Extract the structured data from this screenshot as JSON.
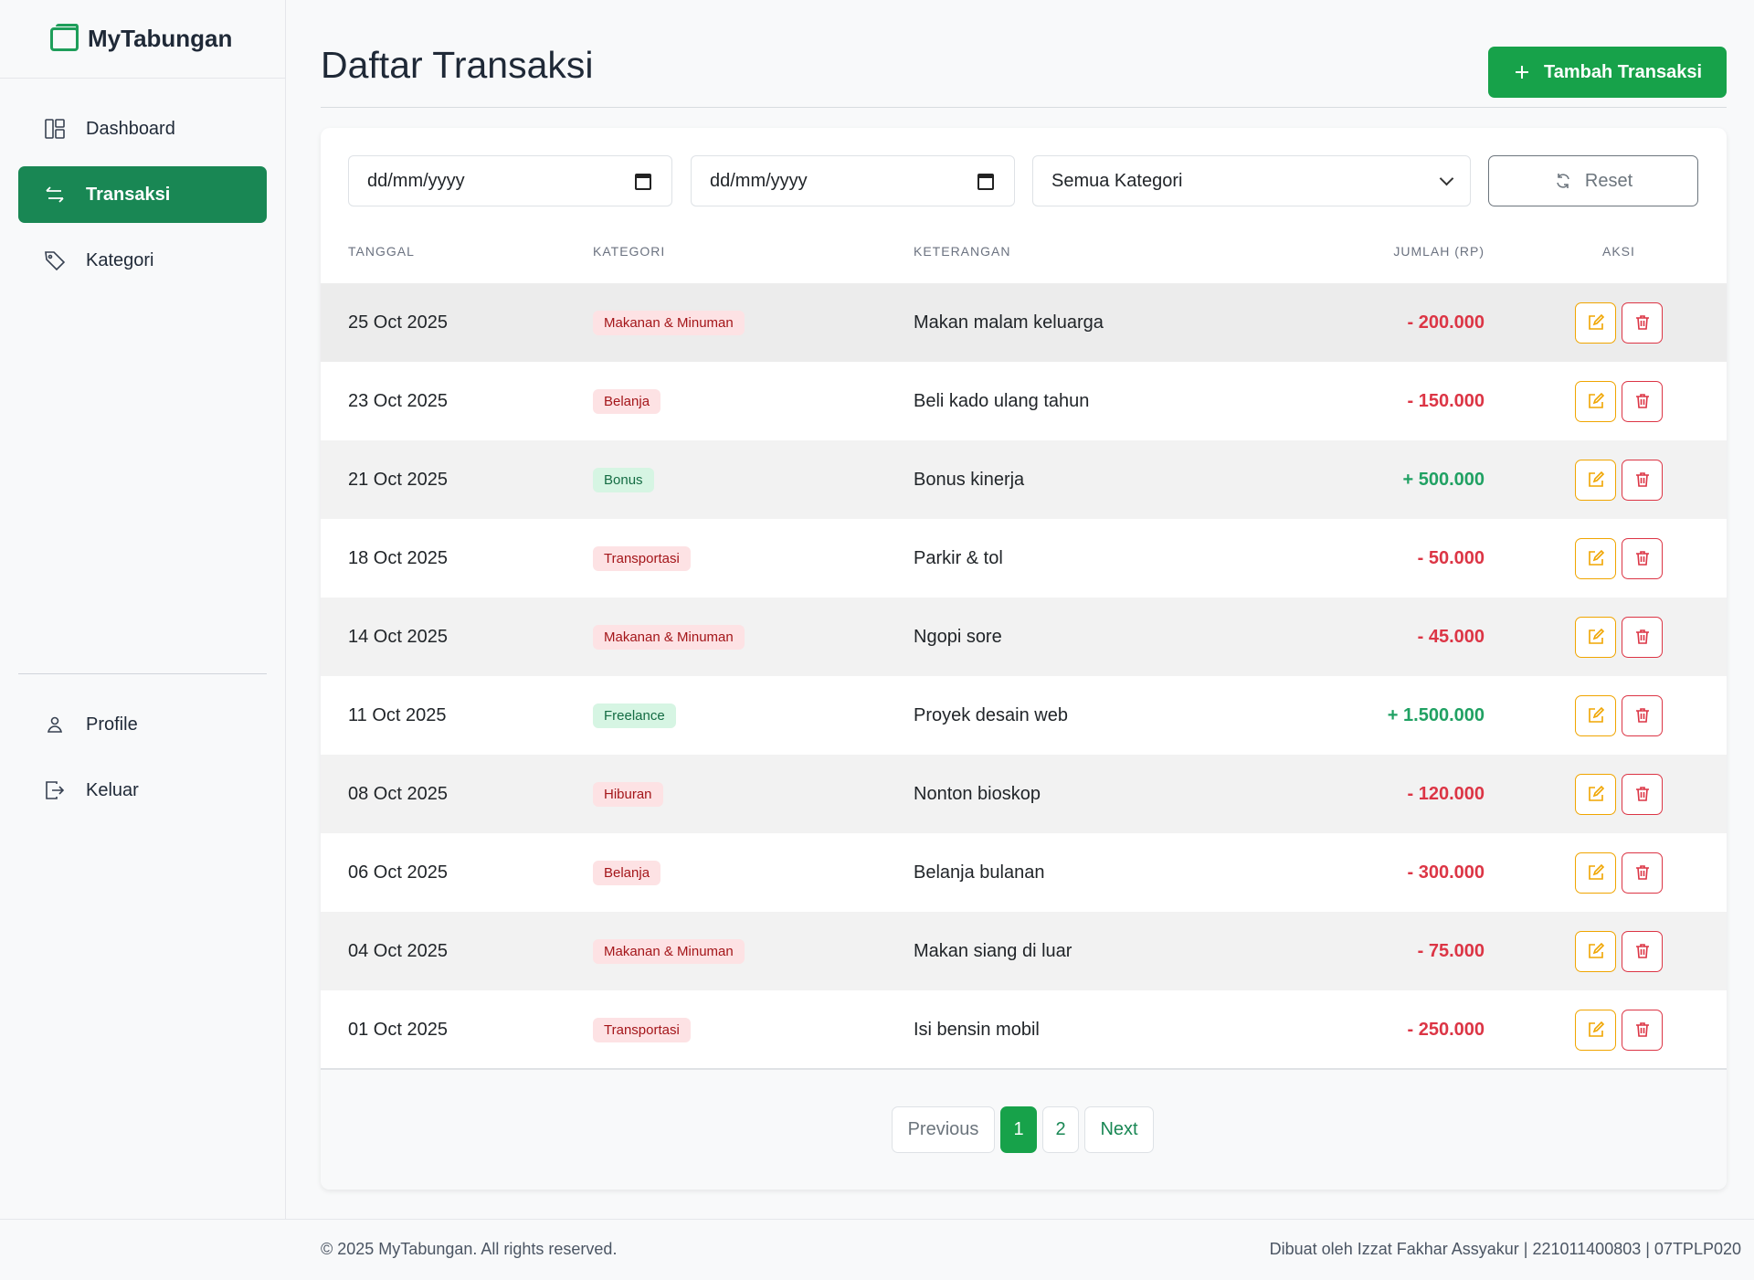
{
  "app": {
    "name": "MyTabungan"
  },
  "sidebar": {
    "items": [
      {
        "label": "Dashboard",
        "icon": "dashboard-icon"
      },
      {
        "label": "Transaksi",
        "icon": "transfer-icon",
        "active": true
      },
      {
        "label": "Kategori",
        "icon": "tag-icon"
      }
    ],
    "bottom": [
      {
        "label": "Profile",
        "icon": "user-icon"
      },
      {
        "label": "Keluar",
        "icon": "logout-icon"
      }
    ]
  },
  "header": {
    "title": "Daftar Transaksi",
    "add_button": "Tambah Transaksi"
  },
  "filters": {
    "date_from_placeholder": "dd/mm/yyyy",
    "date_to_placeholder": "dd/mm/yyyy",
    "category_selected": "Semua Kategori",
    "reset_label": "Reset"
  },
  "table": {
    "columns": [
      "TANGGAL",
      "KATEGORI",
      "KETERANGAN",
      "JUMLAH (RP)",
      "AKSI"
    ],
    "rows": [
      {
        "date": "25 Oct 2025",
        "category": "Makanan & Minuman",
        "type": "out",
        "desc": "Makan malam keluarga",
        "amount": "- 200.000"
      },
      {
        "date": "23 Oct 2025",
        "category": "Belanja",
        "type": "out",
        "desc": "Beli kado ulang tahun",
        "amount": "- 150.000"
      },
      {
        "date": "21 Oct 2025",
        "category": "Bonus",
        "type": "in",
        "desc": "Bonus kinerja",
        "amount": "+ 500.000"
      },
      {
        "date": "18 Oct 2025",
        "category": "Transportasi",
        "type": "out",
        "desc": "Parkir & tol",
        "amount": "- 50.000"
      },
      {
        "date": "14 Oct 2025",
        "category": "Makanan & Minuman",
        "type": "out",
        "desc": "Ngopi sore",
        "amount": "- 45.000"
      },
      {
        "date": "11 Oct 2025",
        "category": "Freelance",
        "type": "in",
        "desc": "Proyek desain web",
        "amount": "+ 1.500.000"
      },
      {
        "date": "08 Oct 2025",
        "category": "Hiburan",
        "type": "out",
        "desc": "Nonton bioskop",
        "amount": "- 120.000"
      },
      {
        "date": "06 Oct 2025",
        "category": "Belanja",
        "type": "out",
        "desc": "Belanja bulanan",
        "amount": "- 300.000"
      },
      {
        "date": "04 Oct 2025",
        "category": "Makanan & Minuman",
        "type": "out",
        "desc": "Makan siang di luar",
        "amount": "- 75.000"
      },
      {
        "date": "01 Oct 2025",
        "category": "Transportasi",
        "type": "out",
        "desc": "Isi bensin mobil",
        "amount": "- 250.000"
      }
    ]
  },
  "pagination": {
    "previous": "Previous",
    "pages": [
      "1",
      "2"
    ],
    "current": "1",
    "next": "Next"
  },
  "footer": {
    "copyright": "© 2025 MyTabungan. All rights reserved.",
    "credit": "Dibuat oleh Izzat Fakhar Assyakur | 221011400803 | 07TPLP020"
  },
  "colors": {
    "brand": "#198754",
    "expense": "#dc3545",
    "income": "#20a163",
    "edit": "#f0a500"
  }
}
